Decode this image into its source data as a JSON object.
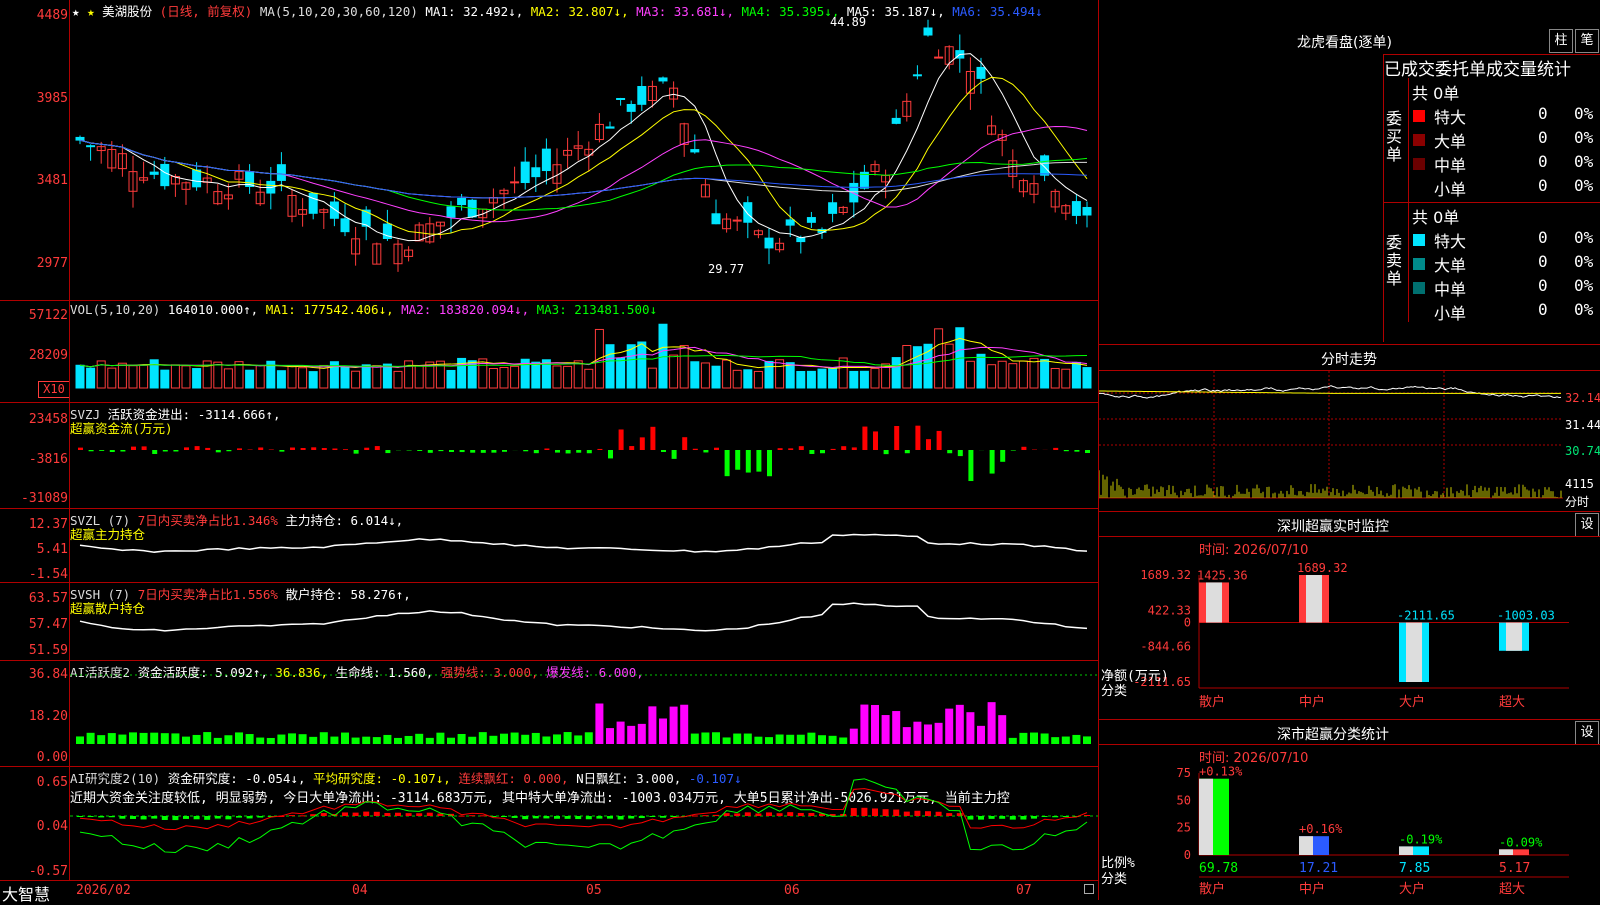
{
  "main": {
    "stock_name": "美湖股份",
    "period_tag": "(日线, 前复权)",
    "ma_label": "MA(5,10,20,30,60,120)",
    "ma1": "MA1: 32.492↓,",
    "ma2": "MA2: 32.807↓,",
    "ma3": "MA3: 33.681↓,",
    "ma4": "MA4: 35.395↓,",
    "ma5": "MA5: 35.187↓,",
    "ma6": "MA6: 35.494↓",
    "axis": [
      "4489",
      "3985",
      "3481",
      "2977"
    ],
    "high_label": "44.89",
    "low_label": "29.77"
  },
  "vol": {
    "label": "VOL(5,10,20)",
    "value": "164010.000↑,",
    "ma1": "MA1: 177542.406↓,",
    "ma2": "MA2: 183820.094↓,",
    "ma3": "MA3: 213481.500↓",
    "axis": [
      "57122",
      "28209"
    ],
    "unit": "X10"
  },
  "svzj": {
    "label": "SVZJ",
    "desc": "活跃资金进出: -3114.666↑,",
    "sub": "超赢资金流(万元)",
    "axis": [
      "23458",
      "-3816",
      "-31089"
    ]
  },
  "svzl": {
    "label": "SVZL (7)",
    "desc1": "7日内买卖净占比1.346%",
    "desc2": "主力持仓: 6.014↓,",
    "sub": "超赢主力持仓",
    "axis": [
      "12.37",
      "5.41",
      "-1.54"
    ]
  },
  "svsh": {
    "label": "SVSH (7)",
    "desc1": "7日内买卖净占比1.556%",
    "desc2": "散户持仓: 58.276↑,",
    "sub": "超赢散户持仓",
    "axis": [
      "63.57",
      "57.47",
      "51.59"
    ]
  },
  "ai2": {
    "label": "AI活跃度2",
    "p1": "资金活跃度: 5.092↑,",
    "p2": "36.836,",
    "p3": "生命线: 1.560,",
    "p4": "强势线: 3.000,",
    "p5": "爆发线: 6.000,",
    "axis": [
      "36.84",
      "18.20",
      "0.00"
    ]
  },
  "ai_research": {
    "label": "AI研究度2(10)",
    "p1": "资金研究度: -0.054↓,",
    "p2": "平均研究度: -0.107↓,",
    "p3": "连续飘红: 0.000,",
    "p4": "N日飘红: 3.000,",
    "p5": "-0.107↓",
    "comment": "近期大资金关注度较低, 明显弱势, 今日大单净流出: -3114.683万元, 其中特大单净流出: -1003.034万元, 大单5日累计净出-5026.921万元, 当前主力控",
    "axis": [
      "0.65",
      "0.04",
      "-0.57"
    ]
  },
  "bottom": {
    "brand": "大智慧",
    "dates": [
      "2026/02",
      "04",
      "05",
      "06",
      "07"
    ]
  },
  "dragon": {
    "title": "龙虎看盘(逐单)",
    "btn1": "柱",
    "btn2": "笔",
    "subtitle": "已成交委托单成交量统计",
    "buy_label": "委买单",
    "sell_label": "委卖单",
    "buy_total": "共 0单",
    "sell_total": "共 0单",
    "buy_rows": [
      {
        "name": "特大",
        "val": "0",
        "pct": "0%",
        "color": "#ff0000"
      },
      {
        "name": "大单",
        "val": "0",
        "pct": "0%",
        "color": "#8b0000"
      },
      {
        "name": "中单",
        "val": "0",
        "pct": "0%",
        "color": "#6b0000"
      },
      {
        "name": "小单",
        "val": "0",
        "pct": "0%",
        "color": ""
      }
    ],
    "sell_rows": [
      {
        "name": "特大",
        "val": "0",
        "pct": "0%",
        "color": "#00e5ff"
      },
      {
        "name": "大单",
        "val": "0",
        "pct": "0%",
        "color": "#008b8b"
      },
      {
        "name": "中单",
        "val": "0",
        "pct": "0%",
        "color": "#007070"
      },
      {
        "name": "小单",
        "val": "0",
        "pct": "0%",
        "color": ""
      }
    ]
  },
  "intraday": {
    "title": "分时走势",
    "axis": [
      "32.14",
      "31.44",
      "30.74"
    ],
    "vol_max": "4115",
    "vol_unit": "分时"
  },
  "szmon": {
    "title": "深圳超赢实时监控",
    "set": "设",
    "time": "时间: 2026/07/10",
    "axis": [
      "1689.32",
      "422.33",
      "0",
      "-844.66",
      "-2111.65"
    ],
    "unit1": "净额(万元)",
    "unit2": "分类",
    "cats": [
      "散户",
      "中户",
      "大户",
      "超大"
    ],
    "values": [
      1425.36,
      1689.32,
      -2111.65,
      -1003.03
    ],
    "labels": [
      "1425.36",
      "1689.32",
      "-2111.65",
      "-1003.03"
    ]
  },
  "szcls": {
    "title": "深市超赢分类统计",
    "set": "设",
    "time": "时间: 2026/07/10",
    "axis": [
      "75",
      "50",
      "25",
      "0"
    ],
    "unit1": "比例%",
    "unit2": "分类",
    "cats": [
      "散户",
      "中户",
      "大户",
      "超大"
    ],
    "values": [
      69.78,
      17.21,
      7.85,
      5.17
    ],
    "values_label": [
      "69.78",
      "17.21",
      "7.85",
      "5.17"
    ],
    "changes": [
      "+0.13%",
      "+0.16%",
      "-0.19%",
      "-0.09%"
    ]
  }
}
